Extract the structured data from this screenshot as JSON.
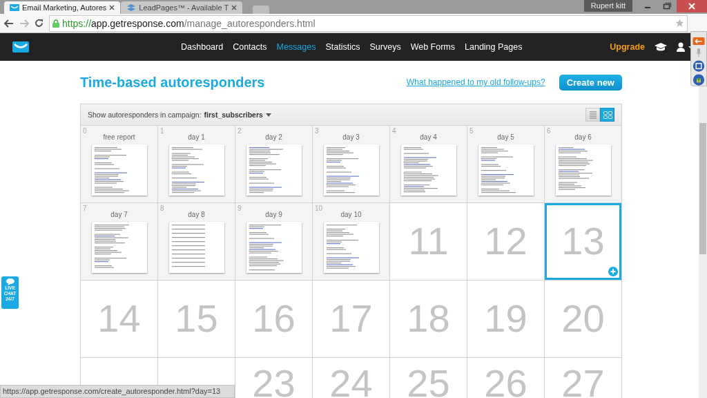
{
  "browser": {
    "tabs": [
      {
        "title": "Email Marketing, Autores",
        "selected": true
      },
      {
        "title": "LeadPages™ - Available T",
        "selected": false
      }
    ],
    "user": "Rupert kitt",
    "url": {
      "scheme": "https://",
      "host": "app.getresponse.com",
      "path": "/manage_autoresponders.html"
    }
  },
  "nav": {
    "items": [
      {
        "label": "Dashboard",
        "selected": false
      },
      {
        "label": "Contacts",
        "selected": false
      },
      {
        "label": "Messages",
        "selected": true
      },
      {
        "label": "Statistics",
        "selected": false
      },
      {
        "label": "Surveys",
        "selected": false
      },
      {
        "label": "Web Forms",
        "selected": false
      },
      {
        "label": "Landing Pages",
        "selected": false
      }
    ],
    "upgrade": "Upgrade"
  },
  "page": {
    "title": "Time-based autoresponders",
    "help_link": "What happened to my old follow-ups?",
    "create_button": "Create new"
  },
  "toolbar": {
    "label": "Show autoresponders in campaign:",
    "campaign": "first_subscribers",
    "views": [
      {
        "kind": "list",
        "selected": false
      },
      {
        "kind": "grid",
        "selected": true
      }
    ]
  },
  "cells": [
    {
      "kind": "message",
      "day": "0",
      "title": "free report",
      "selected": false
    },
    {
      "kind": "message",
      "day": "1",
      "title": "day 1",
      "selected": false
    },
    {
      "kind": "message",
      "day": "2",
      "title": "day 2",
      "selected": false
    },
    {
      "kind": "message",
      "day": "3",
      "title": "day 3",
      "selected": false
    },
    {
      "kind": "message",
      "day": "4",
      "title": "day 4",
      "selected": false
    },
    {
      "kind": "message",
      "day": "5",
      "title": "day 5",
      "selected": false
    },
    {
      "kind": "message",
      "day": "6",
      "title": "day 6",
      "selected": false
    },
    {
      "kind": "message",
      "day": "7",
      "title": "day 7",
      "selected": false
    },
    {
      "kind": "message",
      "day": "8",
      "title": "day 8",
      "selected": false
    },
    {
      "kind": "message",
      "day": "9",
      "title": "day 9",
      "selected": false
    },
    {
      "kind": "message",
      "day": "10",
      "title": "day 10",
      "selected": false
    },
    {
      "kind": "empty",
      "day": "11",
      "selected": false
    },
    {
      "kind": "empty",
      "day": "12",
      "selected": false
    },
    {
      "kind": "empty",
      "day": "13",
      "selected": true
    },
    {
      "kind": "empty",
      "day": "14",
      "selected": false
    },
    {
      "kind": "empty",
      "day": "15",
      "selected": false
    },
    {
      "kind": "empty",
      "day": "16",
      "selected": false
    },
    {
      "kind": "empty",
      "day": "17",
      "selected": false
    },
    {
      "kind": "empty",
      "day": "18",
      "selected": false
    },
    {
      "kind": "empty",
      "day": "19",
      "selected": false
    },
    {
      "kind": "empty",
      "day": "20",
      "selected": false
    },
    {
      "kind": "blank",
      "selected": false
    },
    {
      "kind": "blank",
      "selected": false
    },
    {
      "kind": "empty",
      "day": "23",
      "selected": false
    },
    {
      "kind": "empty",
      "day": "24",
      "selected": false
    },
    {
      "kind": "empty",
      "day": "25",
      "selected": false
    },
    {
      "kind": "empty",
      "day": "26",
      "selected": false
    },
    {
      "kind": "empty",
      "day": "27",
      "selected": false
    }
  ],
  "live_chat": [
    "LIVE",
    "CHAT",
    "24/7"
  ],
  "status_bar": "https://app.getresponse.com/create_autoresponder.html?day=13"
}
